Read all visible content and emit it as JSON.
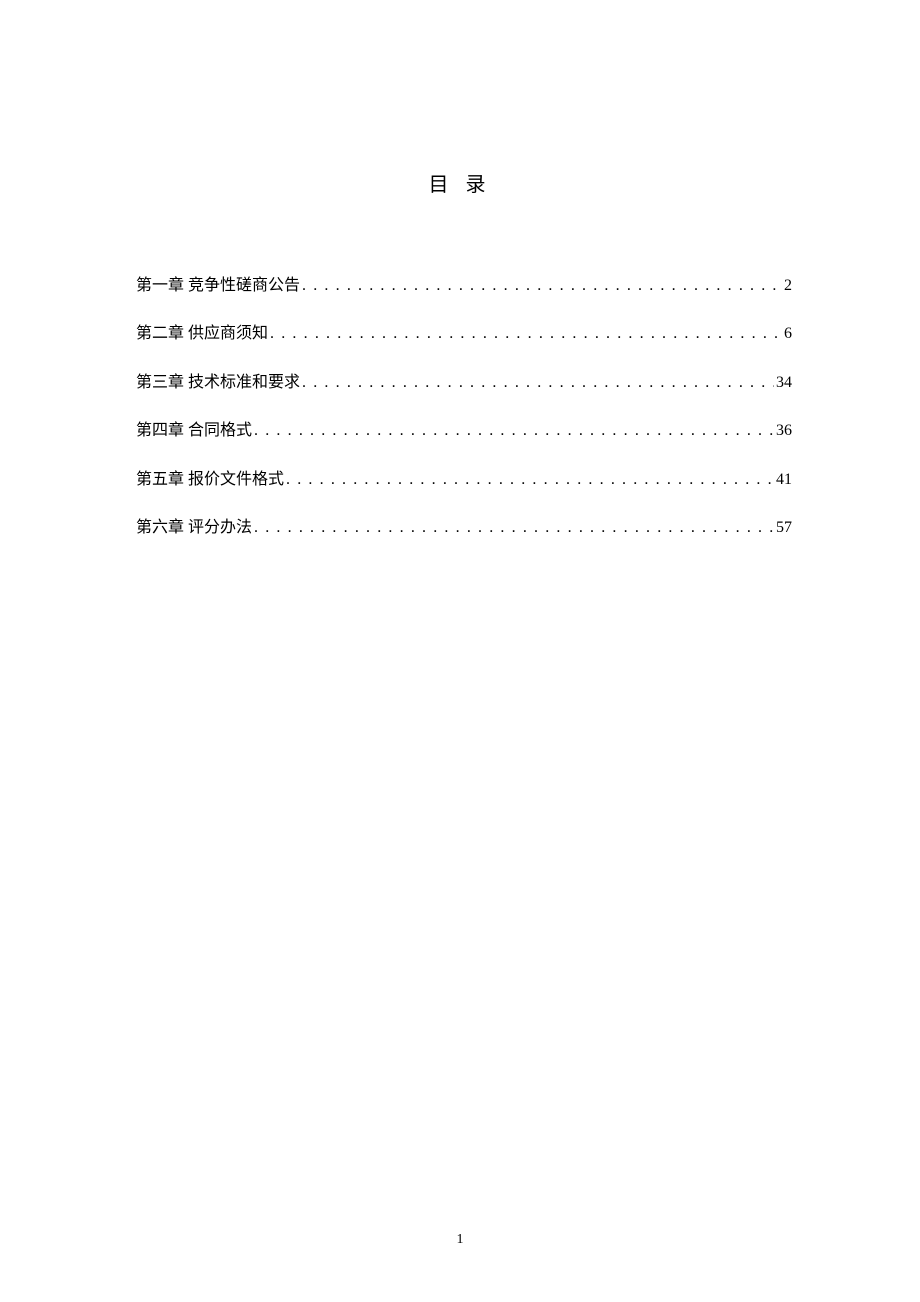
{
  "title": "目 录",
  "toc": {
    "entries": [
      {
        "label": "第一章   竞争性磋商公告",
        "page": "2"
      },
      {
        "label": "第二章  供应商须知",
        "page": "6"
      },
      {
        "label": "第三章  技术标准和要求",
        "page": "34"
      },
      {
        "label": "第四章  合同格式",
        "page": "36"
      },
      {
        "label": "第五章   报价文件格式",
        "page": "41"
      },
      {
        "label": "第六章   评分办法",
        "page": "57"
      }
    ]
  },
  "page_number": "1"
}
